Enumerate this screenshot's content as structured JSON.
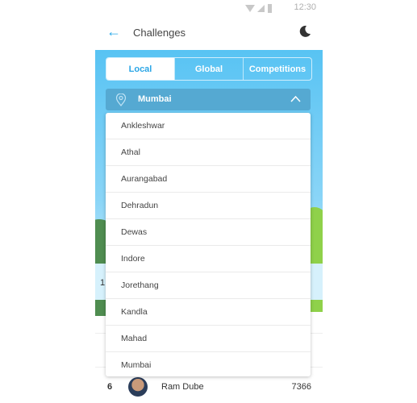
{
  "status": {
    "time": "12:30"
  },
  "appbar": {
    "title": "Challenges",
    "back_icon": "arrow-left-icon",
    "theme_icon": "moon-icon"
  },
  "tabs": [
    {
      "label": "Local",
      "active": true
    },
    {
      "label": "Global"
    },
    {
      "label": "Competitions"
    }
  ],
  "location": {
    "selected": "Mumbai",
    "icon": "map-pin-icon",
    "expanded": true
  },
  "options": [
    "Ankleshwar",
    "Athal",
    "Aurangabad",
    "Dehradun",
    "Dewas",
    "Indore",
    "Jorethang",
    "Kandla",
    "Mahad",
    "Mumbai"
  ],
  "leaderboard": {
    "partial_rank": "1",
    "row": {
      "rank": "6",
      "name": "Ram Dube",
      "score": "7366"
    }
  },
  "colors": {
    "accent": "#29a8e8",
    "dropdown": "#55a9d2"
  }
}
